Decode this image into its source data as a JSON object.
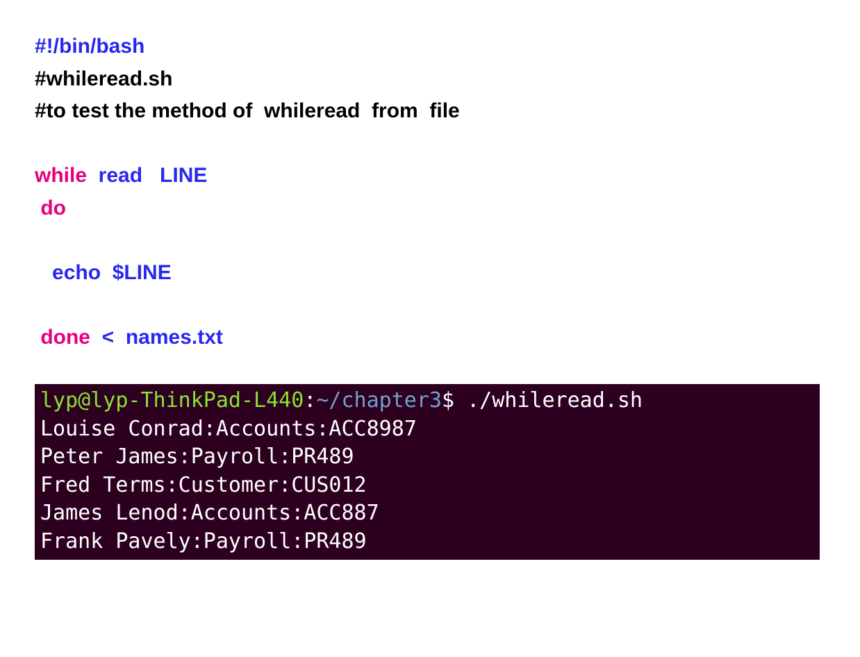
{
  "script": {
    "shebang": "#!/bin/bash",
    "comment1": "#whileread.sh",
    "comment2": "#to test the method of  whileread  from  file",
    "while_kw": "while",
    "read_cmd": "  read   LINE",
    "do_kw": " do",
    "echo_line": "   echo  $LINE",
    "done_kw": " done",
    "redirect": "  <  names.txt"
  },
  "terminal": {
    "user": "lyp@lyp-ThinkPad-L440",
    "colon": ":",
    "path": "~/chapter3",
    "dollar": "$ ",
    "command": "./whileread.sh",
    "output": [
      "Louise Conrad:Accounts:ACC8987",
      "Peter James:Payroll:PR489",
      "Fred Terms:Customer:CUS012",
      "James Lenod:Accounts:ACC887",
      "Frank Pavely:Payroll:PR489"
    ]
  }
}
